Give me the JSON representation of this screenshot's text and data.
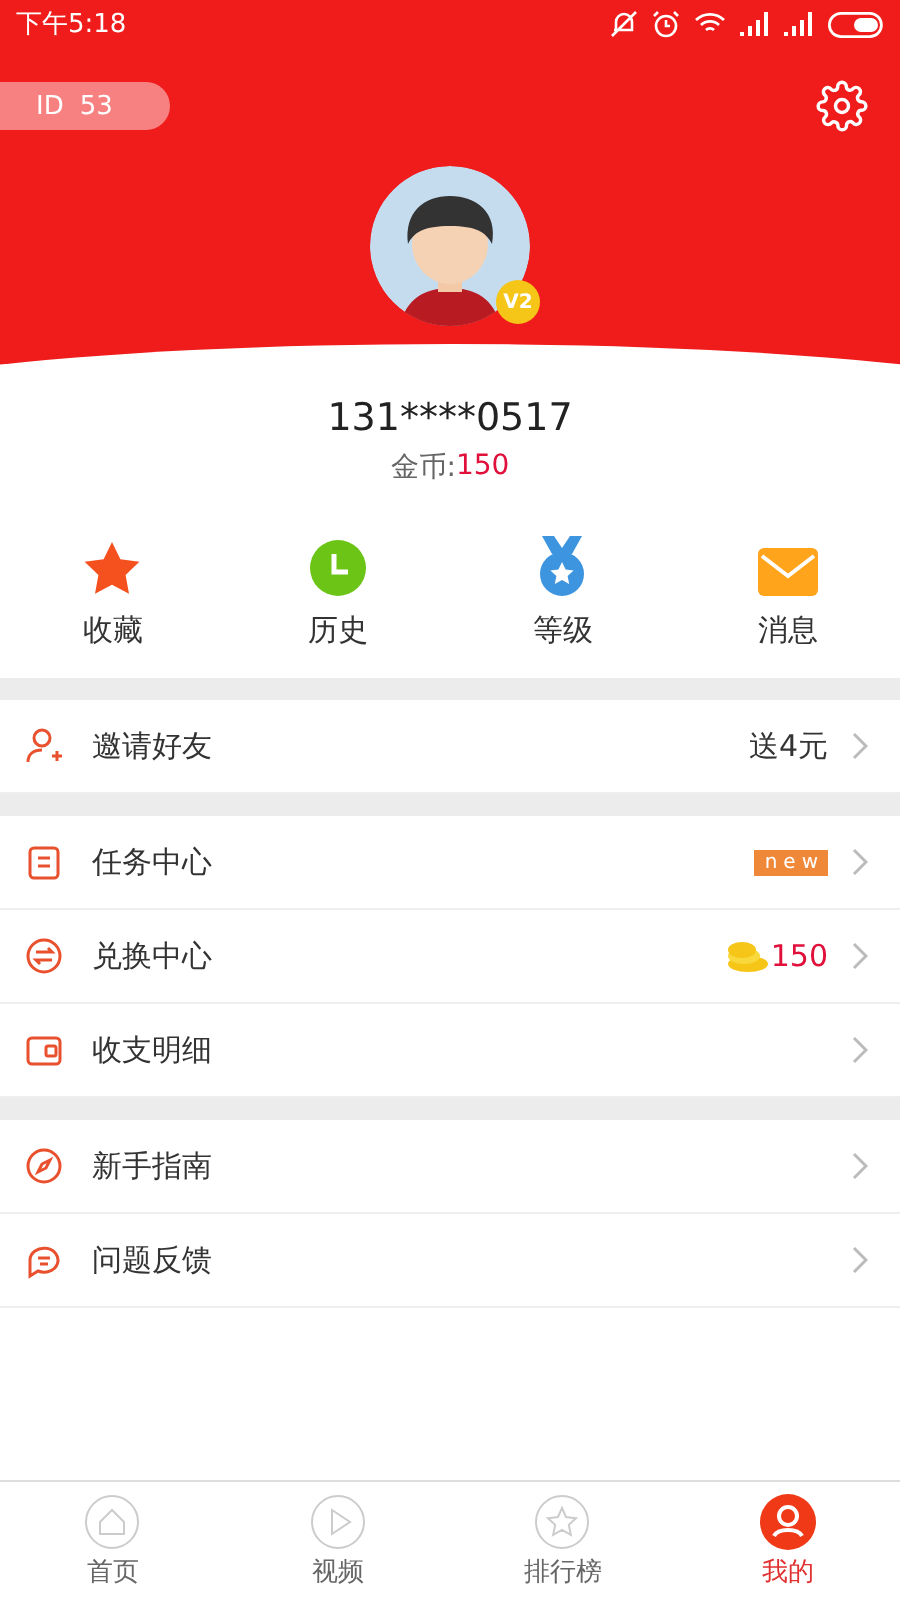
{
  "status_bar": {
    "time": "下午5:18"
  },
  "profile": {
    "id_label": "ID",
    "id_value": "53",
    "level_badge": "V2",
    "phone": "131****0517",
    "coins_label": "金币:",
    "coins_value": "150"
  },
  "shortcuts": [
    {
      "label": "收藏"
    },
    {
      "label": "历史"
    },
    {
      "label": "等级"
    },
    {
      "label": "消息"
    }
  ],
  "menu_groups": [
    {
      "rows": [
        {
          "label": "邀请好友",
          "kind": "text",
          "value": "送4元"
        }
      ]
    },
    {
      "rows": [
        {
          "label": "任务中心",
          "kind": "new",
          "value": "new"
        },
        {
          "label": "兑换中心",
          "kind": "coins",
          "value": "150"
        },
        {
          "label": "收支明细",
          "kind": "plain"
        }
      ]
    },
    {
      "rows": [
        {
          "label": "新手指南",
          "kind": "plain"
        },
        {
          "label": "问题反馈",
          "kind": "plain"
        }
      ]
    }
  ],
  "bottom_nav": [
    {
      "label": "首页",
      "selected": false
    },
    {
      "label": "视频",
      "selected": false
    },
    {
      "label": "排行榜",
      "selected": false
    },
    {
      "label": "我的",
      "selected": true
    }
  ]
}
